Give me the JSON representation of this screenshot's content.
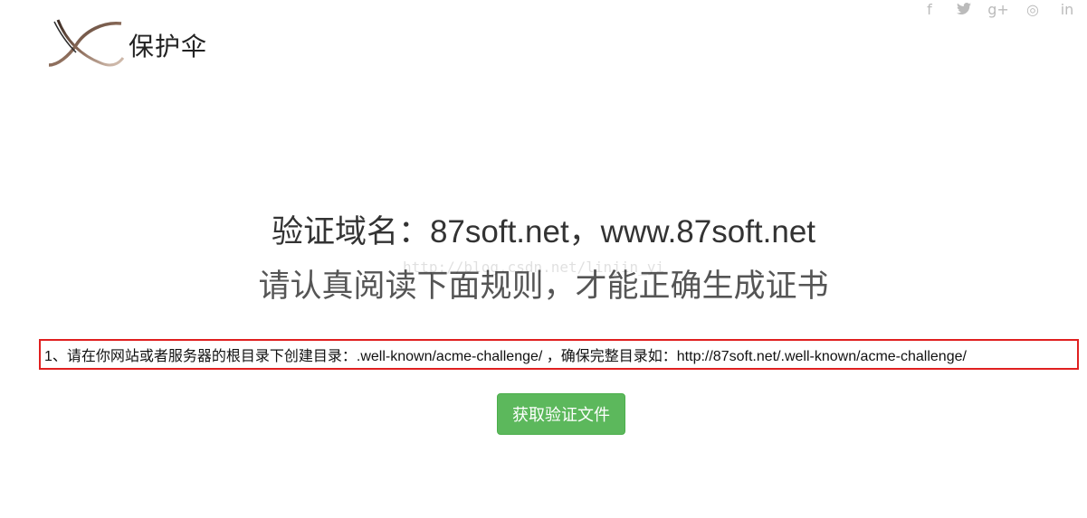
{
  "brand": {
    "logo_text": "保护伞"
  },
  "social": [
    {
      "icon": "facebook-icon",
      "glyph": "f"
    },
    {
      "icon": "twitter-icon",
      "glyph": "🐦"
    },
    {
      "icon": "google-plus-icon",
      "glyph": "g+"
    },
    {
      "icon": "dribbble-icon",
      "glyph": "◎"
    },
    {
      "icon": "linkedin-icon",
      "glyph": "in"
    }
  ],
  "main": {
    "domain_title": "验证域名：87soft.net，www.87soft.net",
    "subtitle": "请认真阅读下面规则，才能正确生成证书",
    "instruction": "1、请在你网站或者服务器的根目录下创建目录：.well-known/acme-challenge/ ，确保完整目录如：http://87soft.net/.well-known/acme-challenge/",
    "button_label": "获取验证文件"
  },
  "watermark": "http://blog.csdn.net/linjin_yi",
  "colors": {
    "button": "#5cb85c",
    "highlight_border": "#e02020",
    "social_icon": "#bbbbbb"
  }
}
